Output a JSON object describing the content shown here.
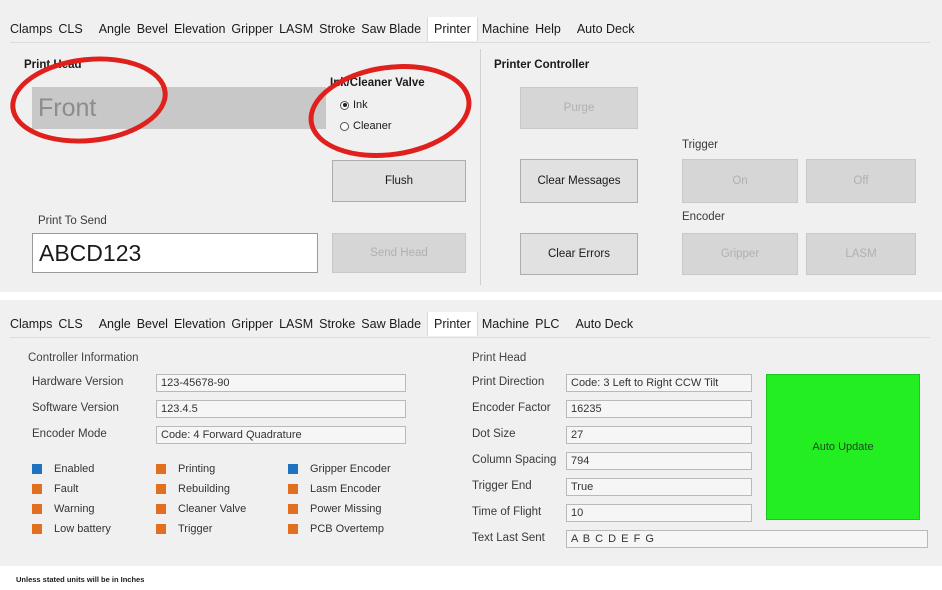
{
  "top_tabs": [
    "Clamps",
    "CLS",
    "Angle",
    "Bevel",
    "Elevation",
    "Gripper",
    "LASM",
    "Stroke",
    "Saw Blade",
    "Printer",
    "Machine",
    "Help",
    "Auto Deck"
  ],
  "bottom_tabs": [
    "Clamps",
    "CLS",
    "Angle",
    "Bevel",
    "Elevation",
    "Gripper",
    "LASM",
    "Stroke",
    "Saw Blade",
    "Printer",
    "Machine",
    "PLC",
    "Auto Deck"
  ],
  "active_tab": "Printer",
  "print_head": {
    "title": "Print Head",
    "value": "Front",
    "valve_title": "Ink/Cleaner Valve",
    "valve_options": [
      "Ink",
      "Cleaner"
    ],
    "valve_selected": "Ink",
    "flush_label": "Flush",
    "print_to_send_label": "Print To Send",
    "print_to_send_value": "ABCD123",
    "send_label": "Send Head"
  },
  "printer_controller": {
    "title": "Printer Controller",
    "purge_label": "Purge",
    "clear_messages_label": "Clear Messages",
    "clear_errors_label": "Clear Errors",
    "trigger_label": "Trigger",
    "on_label": "On",
    "off_label": "Off",
    "encoder_label": "Encoder",
    "gripper_label": "Gripper",
    "lasm_label": "LASM"
  },
  "controller_info": {
    "title": "Controller Information",
    "rows": [
      {
        "label": "Hardware Version",
        "value": "123-45678-90"
      },
      {
        "label": "Software Version",
        "value": "123.4.5"
      },
      {
        "label": "Encoder Mode",
        "value": "Code: 4 Forward Quadrature"
      }
    ],
    "indicators": [
      {
        "label": "Enabled",
        "color": "#1e73be"
      },
      {
        "label": "Fault",
        "color": "#e07020"
      },
      {
        "label": "Warning",
        "color": "#e07020"
      },
      {
        "label": "Low battery",
        "color": "#e07020"
      },
      {
        "label": "Printing",
        "color": "#e07020"
      },
      {
        "label": "Rebuilding",
        "color": "#e07020"
      },
      {
        "label": "Cleaner Valve",
        "color": "#e07020"
      },
      {
        "label": "Trigger",
        "color": "#e07020"
      },
      {
        "label": "Gripper Encoder",
        "color": "#1e73be"
      },
      {
        "label": "Lasm Encoder",
        "color": "#e07020"
      },
      {
        "label": "Power Missing",
        "color": "#e07020"
      },
      {
        "label": "PCB Overtemp",
        "color": "#e07020"
      }
    ]
  },
  "print_head_info": {
    "title": "Print Head",
    "rows": [
      {
        "label": "Print Direction",
        "value": "Code: 3 Left to Right CCW Tilt"
      },
      {
        "label": "Encoder Factor",
        "value": "16235"
      },
      {
        "label": "Dot Size",
        "value": "27"
      },
      {
        "label": "Column Spacing",
        "value": "794"
      },
      {
        "label": "Trigger End",
        "value": "True"
      },
      {
        "label": "Time of Flight",
        "value": "10"
      },
      {
        "label": "Text Last Sent",
        "value": "A B C D E F G"
      }
    ],
    "auto_update_label": "Auto Update",
    "auto_update_color": "#22ee22"
  },
  "footer_note": "Unless stated units will be in Inches"
}
